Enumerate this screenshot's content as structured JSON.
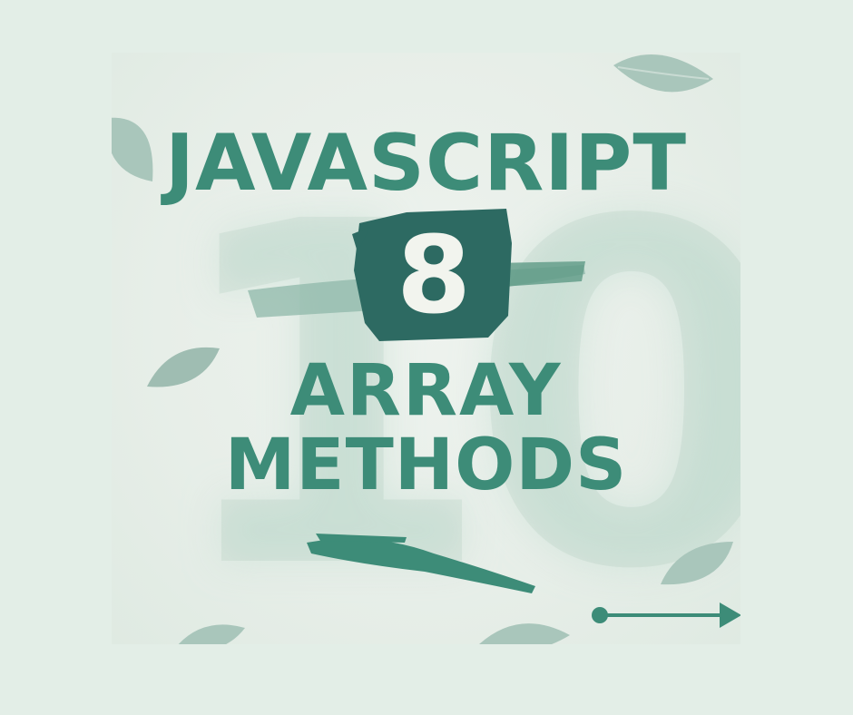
{
  "graphic": {
    "title_line1": "JAVASCRIPT",
    "number": "8",
    "title_line2": "ARRAY",
    "title_line3": "METHODS",
    "watermark": "10",
    "colors": {
      "page_bg": "#e3eee7",
      "text_green": "#3d8c78",
      "brush_dark": "#2d6a62",
      "number_text": "#f2f4ee",
      "leaf": "#9fbdb2"
    },
    "icons": [
      "leaf-icon",
      "brush-stroke",
      "arrow-right-icon"
    ]
  }
}
